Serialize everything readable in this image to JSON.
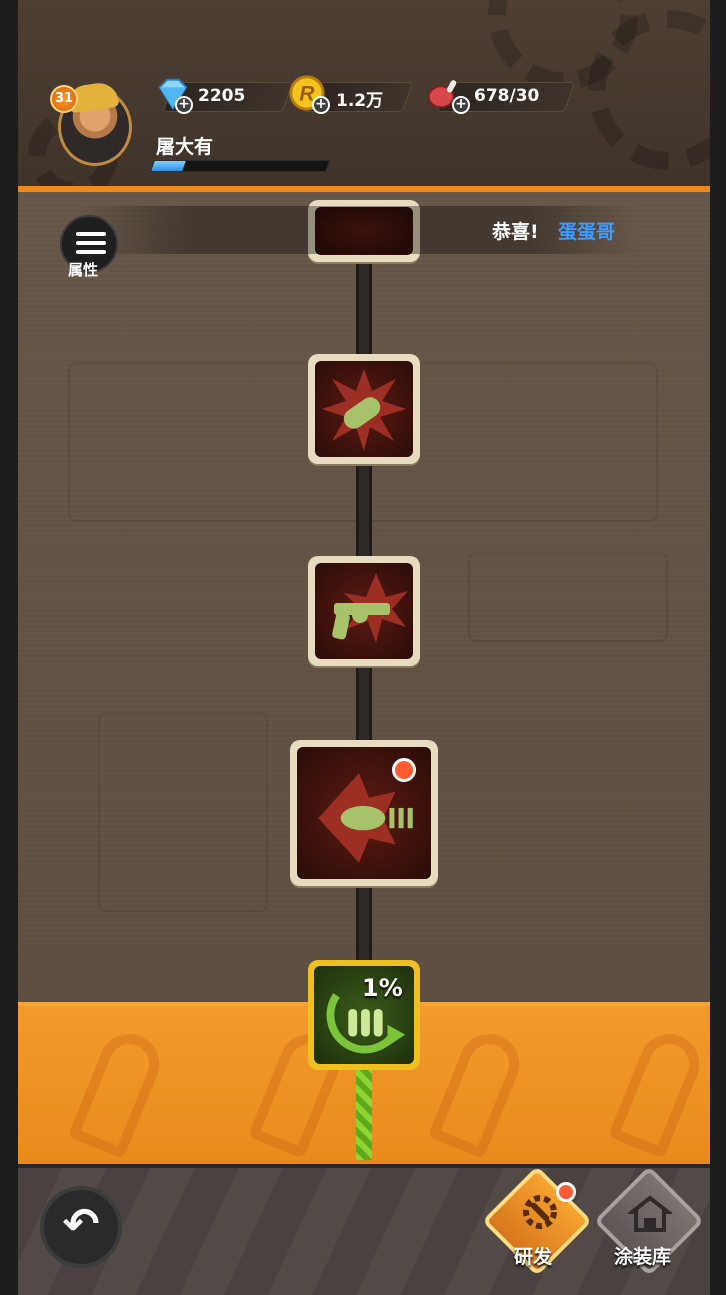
{
  "player": {
    "level": "31",
    "name": "屠大有",
    "xp_fraction": 0.18
  },
  "resources": {
    "gems": "2205",
    "coins": "1.2万",
    "stamina": "678/30"
  },
  "ticker": {
    "prefix": "恭喜!",
    "name": "蛋蛋哥"
  },
  "attributes": {
    "label": "属性"
  },
  "skill_nodes": [
    {
      "icon": "bullet-impact-icon",
      "state": "unlocked"
    },
    {
      "icon": "revolver-icon",
      "state": "unlocked"
    },
    {
      "icon": "bullet-tail-icon",
      "state": "unlocked",
      "notification": true
    },
    {
      "icon": "ammo-reload-icon",
      "state": "researching",
      "progress": "1%"
    }
  ],
  "bottom_nav": {
    "research": "研发",
    "paint_shop": "涂装库"
  },
  "colors": {
    "accent_orange": "#f08a1c",
    "link_blue": "#3f9bff",
    "active_gold": "#f0c020"
  }
}
